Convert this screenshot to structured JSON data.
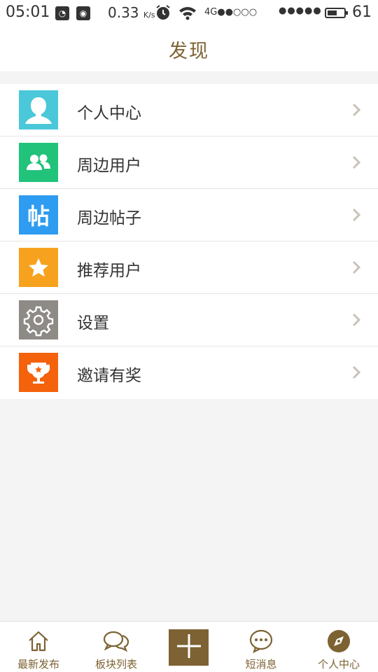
{
  "status_bar": {
    "time": "05:01",
    "speed": "0.33",
    "speed_unit": "K/s",
    "network": "4G",
    "signal_a": "●●○○○",
    "signal_b": "●●●●●",
    "battery_level": "61",
    "battery_fraction": 0.61
  },
  "header": {
    "title": "发现"
  },
  "menu": {
    "items": [
      {
        "label": "个人中心",
        "icon": "avatar-icon",
        "color": "#4ac8d9"
      },
      {
        "label": "周边用户",
        "icon": "users-icon",
        "color": "#21c27a"
      },
      {
        "label": "周边帖子",
        "icon": "post-icon",
        "glyph": "帖",
        "color": "#2e9cf0"
      },
      {
        "label": "推荐用户",
        "icon": "star-icon",
        "color": "#f7a21e"
      },
      {
        "label": "设置",
        "icon": "gear-icon",
        "color": "#8e8a86"
      },
      {
        "label": "邀请有奖",
        "icon": "trophy-icon",
        "color": "#f4620c"
      }
    ]
  },
  "tab_bar": {
    "tabs": [
      {
        "label": "最新发布",
        "icon": "home-icon"
      },
      {
        "label": "板块列表",
        "icon": "chat-bubbles-icon"
      },
      {
        "label": "",
        "icon": "plus-icon"
      },
      {
        "label": "短消息",
        "icon": "message-icon"
      },
      {
        "label": "个人中心",
        "icon": "compass-icon"
      }
    ]
  },
  "colors": {
    "accent": "#7d6233",
    "background": "#f4f4f4"
  }
}
